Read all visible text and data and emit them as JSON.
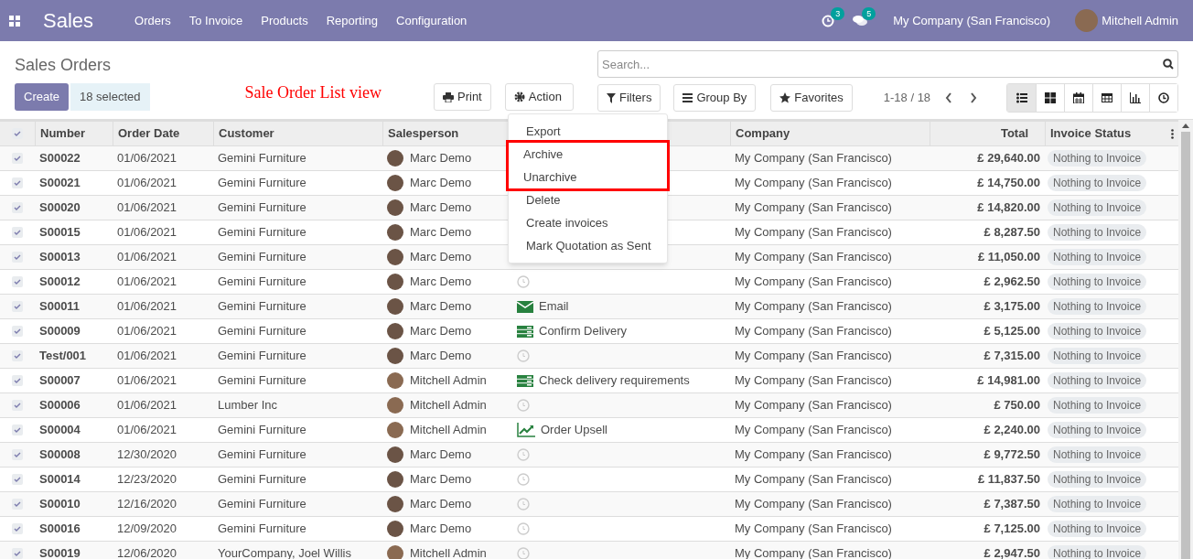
{
  "navbar": {
    "app": "Sales",
    "menu": [
      "Orders",
      "To Invoice",
      "Products",
      "Reporting",
      "Configuration"
    ],
    "activity_count": "3",
    "message_count": "5",
    "company": "My Company (San Francisco)",
    "user": "Mitchell Admin"
  },
  "title": "Sales Orders",
  "create_button": "Create",
  "selection": "18 selected",
  "annotation": "Sale Order List view",
  "print_button": "Print",
  "action_button": "Action",
  "search": {
    "placeholder": "Search..."
  },
  "filters": [
    "Filters",
    "Group By",
    "Favorites"
  ],
  "pager": "1-18 / 18",
  "views": [
    {
      "kind": "list",
      "selected": true
    },
    {
      "kind": "kanban",
      "selected": false
    },
    {
      "kind": "calendar",
      "selected": false
    },
    {
      "kind": "pivot",
      "selected": false
    },
    {
      "kind": "graph",
      "selected": false
    },
    {
      "kind": "activity",
      "selected": false
    }
  ],
  "action_menu": [
    {
      "label": "Export",
      "highlighted": false
    },
    {
      "label": "Archive",
      "highlighted": true
    },
    {
      "label": "Unarchive",
      "highlighted": true
    },
    {
      "label": "Delete",
      "highlighted": false
    },
    {
      "label": "Create invoices",
      "highlighted": false
    },
    {
      "label": "Mark Quotation as Sent",
      "highlighted": false
    }
  ],
  "table": {
    "all_checked": true,
    "columns": [
      "Number",
      "Order Date",
      "Customer",
      "Salesperson",
      "Company",
      "Total",
      "Invoice Status"
    ],
    "rows": [
      {
        "checked": true,
        "number": "S00022",
        "date": "01/06/2021",
        "customer": "Gemini Furniture",
        "salesperson": "Marc Demo",
        "company": "My Company (San Francisco)",
        "total": "£ 29,640.00",
        "status": "Nothing to Invoice"
      },
      {
        "checked": true,
        "number": "S00021",
        "date": "01/06/2021",
        "customer": "Gemini Furniture",
        "salesperson": "Marc Demo",
        "company": "My Company (San Francisco)",
        "total": "£ 14,750.00",
        "status": "Nothing to Invoice"
      },
      {
        "checked": true,
        "number": "S00020",
        "date": "01/06/2021",
        "customer": "Gemini Furniture",
        "salesperson": "Marc Demo",
        "company": "My Company (San Francisco)",
        "total": "£ 14,820.00",
        "status": "Nothing to Invoice"
      },
      {
        "checked": true,
        "number": "S00015",
        "date": "01/06/2021",
        "customer": "Gemini Furniture",
        "salesperson": "Marc Demo",
        "company": "My Company (San Francisco)",
        "total": "£ 8,287.50",
        "status": "Nothing to Invoice"
      },
      {
        "checked": true,
        "number": "S00013",
        "date": "01/06/2021",
        "customer": "Gemini Furniture",
        "salesperson": "Marc Demo",
        "company": "My Company (San Francisco)",
        "total": "£ 11,050.00",
        "status": "Nothing to Invoice"
      },
      {
        "checked": true,
        "number": "S00012",
        "date": "01/06/2021",
        "customer": "Gemini Furniture",
        "salesperson": "Marc Demo",
        "activity": {
          "kind": "clock"
        },
        "company": "My Company (San Francisco)",
        "total": "£ 2,962.50",
        "status": "Nothing to Invoice"
      },
      {
        "checked": true,
        "number": "S00011",
        "date": "01/06/2021",
        "customer": "Gemini Furniture",
        "salesperson": "Marc Demo",
        "activity": {
          "kind": "email",
          "label": "Email"
        },
        "company": "My Company (San Francisco)",
        "total": "£ 3,175.00",
        "status": "Nothing to Invoice"
      },
      {
        "checked": true,
        "number": "S00009",
        "date": "01/06/2021",
        "customer": "Gemini Furniture",
        "salesperson": "Marc Demo",
        "activity": {
          "kind": "todo",
          "label": "Confirm Delivery"
        },
        "company": "My Company (San Francisco)",
        "total": "£ 5,125.00",
        "status": "Nothing to Invoice"
      },
      {
        "checked": true,
        "number": "Test/001",
        "date": "01/06/2021",
        "customer": "Gemini Furniture",
        "salesperson": "Marc Demo",
        "activity": {
          "kind": "clock"
        },
        "company": "My Company (San Francisco)",
        "total": "£ 7,315.00",
        "status": "Nothing to Invoice"
      },
      {
        "checked": true,
        "number": "S00007",
        "date": "01/06/2021",
        "customer": "Gemini Furniture",
        "salesperson": "Mitchell Admin",
        "activity": {
          "kind": "todo",
          "label": "Check delivery requirements"
        },
        "company": "My Company (San Francisco)",
        "total": "£ 14,981.00",
        "status": "Nothing to Invoice"
      },
      {
        "checked": true,
        "number": "S00006",
        "date": "01/06/2021",
        "customer": "Lumber Inc",
        "salesperson": "Mitchell Admin",
        "activity": {
          "kind": "clock"
        },
        "company": "My Company (San Francisco)",
        "total": "£ 750.00",
        "status": "Nothing to Invoice"
      },
      {
        "checked": true,
        "number": "S00004",
        "date": "01/06/2021",
        "customer": "Gemini Furniture",
        "salesperson": "Mitchell Admin",
        "activity": {
          "kind": "upsell",
          "label": "Order Upsell"
        },
        "company": "My Company (San Francisco)",
        "total": "£ 2,240.00",
        "status": "Nothing to Invoice"
      },
      {
        "checked": true,
        "number": "S00008",
        "date": "12/30/2020",
        "customer": "Gemini Furniture",
        "salesperson": "Marc Demo",
        "activity": {
          "kind": "clock"
        },
        "company": "My Company (San Francisco)",
        "total": "£ 9,772.50",
        "status": "Nothing to Invoice"
      },
      {
        "checked": true,
        "number": "S00014",
        "date": "12/23/2020",
        "customer": "Gemini Furniture",
        "salesperson": "Marc Demo",
        "activity": {
          "kind": "clock"
        },
        "company": "My Company (San Francisco)",
        "total": "£ 11,837.50",
        "status": "Nothing to Invoice"
      },
      {
        "checked": true,
        "number": "S00010",
        "date": "12/16/2020",
        "customer": "Gemini Furniture",
        "salesperson": "Marc Demo",
        "activity": {
          "kind": "clock"
        },
        "company": "My Company (San Francisco)",
        "total": "£ 7,387.50",
        "status": "Nothing to Invoice"
      },
      {
        "checked": true,
        "number": "S00016",
        "date": "12/09/2020",
        "customer": "Gemini Furniture",
        "salesperson": "Marc Demo",
        "activity": {
          "kind": "clock"
        },
        "company": "My Company (San Francisco)",
        "total": "£ 7,125.00",
        "status": "Nothing to Invoice"
      },
      {
        "checked": true,
        "number": "S00019",
        "date": "12/06/2020",
        "customer": "YourCompany, Joel Willis",
        "salesperson": "Mitchell Admin",
        "activity": {
          "kind": "clock"
        },
        "company": "My Company (San Francisco)",
        "total": "£ 2,947.50",
        "status": "Nothing to Invoice"
      }
    ]
  }
}
